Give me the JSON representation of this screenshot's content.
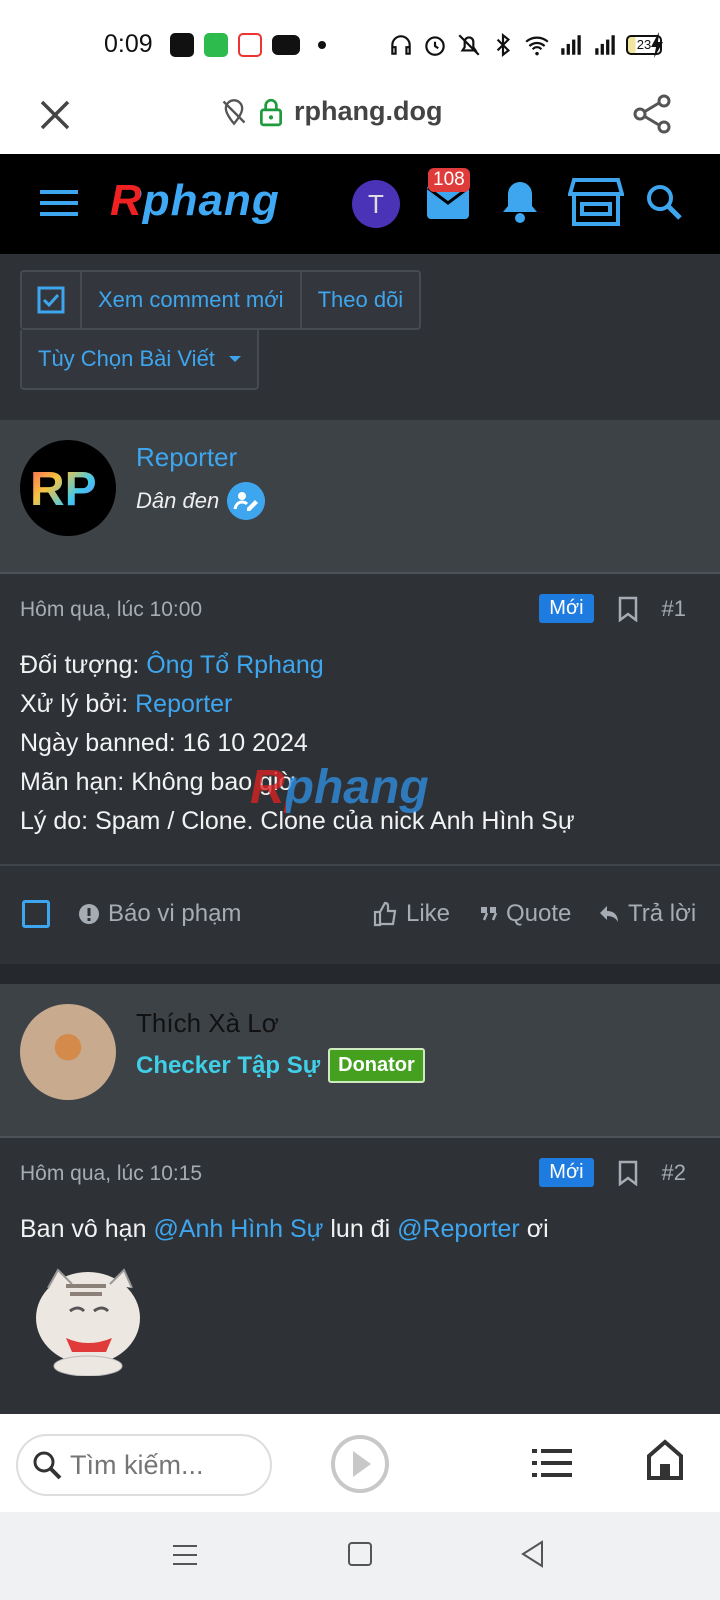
{
  "status": {
    "time": "0:09",
    "battery": "23"
  },
  "browser": {
    "domain": "rphang.dog"
  },
  "site": {
    "logo": "Rphang",
    "avatar_letter": "T",
    "mail_count": "108"
  },
  "actions": {
    "watch_new": "Xem comment mới",
    "follow": "Theo dõi",
    "post_options": "Tùy Chọn Bài Viết"
  },
  "posts": [
    {
      "username": "Reporter",
      "user_title": "Dân đen",
      "avatar_text": "RP",
      "time": "Hôm qua, lúc 10:00",
      "new_label": "Mới",
      "number": "#1",
      "lines": [
        {
          "label": "Đối tượng: ",
          "value": "Ông Tổ Rphang",
          "link": true
        },
        {
          "label": "Xử lý bởi: ",
          "value": "Reporter",
          "link": true
        },
        {
          "label": "Ngày banned: ",
          "value": "16 10 2024",
          "link": false
        },
        {
          "label": "Mãn hạn: ",
          "value": "Không bao giờ",
          "link": false
        },
        {
          "label": "Lý do: ",
          "value": "Spam / Clone. Clone của nick Anh Hình Sự",
          "link": false
        }
      ],
      "report": "Báo vi phạm",
      "like": "Like",
      "quote": "Quote",
      "reply": "Trả lời"
    },
    {
      "username": "Thích Xà Lơ",
      "user_title": "Checker Tập Sự",
      "banner": "Donator",
      "time": "Hôm qua, lúc 10:15",
      "new_label": "Mới",
      "number": "#2",
      "text_before": "Ban vô hạn ",
      "mention1": "@Anh Hình Sự",
      "text_mid": " lun đi ",
      "mention2": "@Reporter",
      "text_after": " ơi"
    }
  ],
  "watermark": "Rphang",
  "bottom": {
    "search_placeholder": "Tìm kiếm..."
  },
  "colors": {
    "accent": "#3ea6ee",
    "new_badge": "#1e7ce0",
    "donator": "#44a01e",
    "mail_badge": "#e03b3b"
  }
}
